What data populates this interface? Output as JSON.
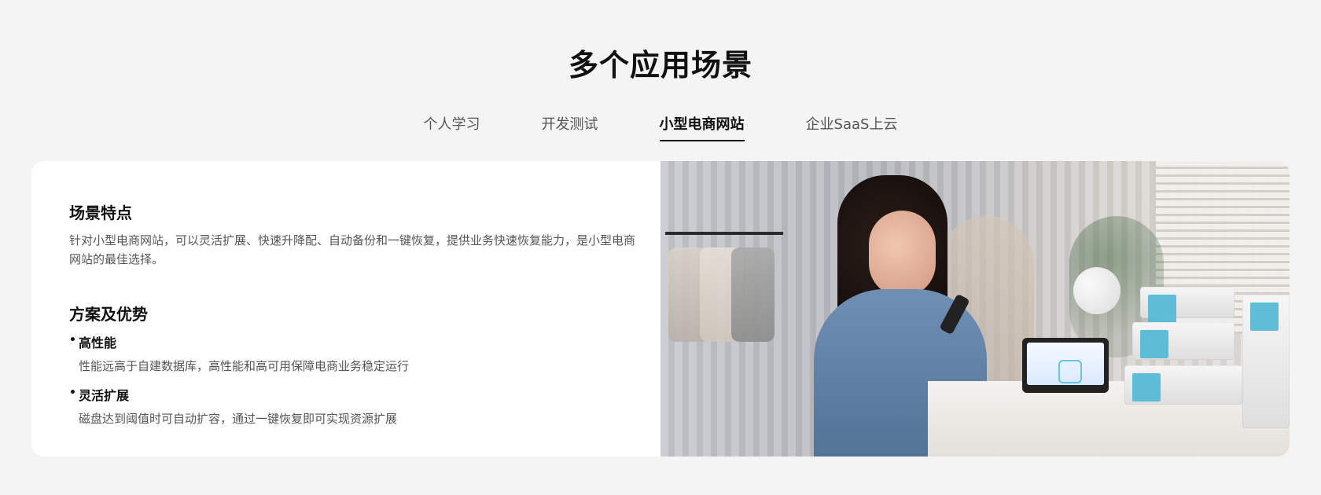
{
  "title": "多个应用场景",
  "tabs": [
    {
      "label": "个人学习",
      "active": false
    },
    {
      "label": "开发测试",
      "active": false
    },
    {
      "label": "小型电商网站",
      "active": true
    },
    {
      "label": "企业SaaS上云",
      "active": false
    }
  ],
  "card": {
    "scene": {
      "heading": "场景特点",
      "description": "针对小型电商网站，可以灵活扩展、快速升降配、自动备份和一键恢复，提供业务快速恢复能力，是小型电商网站的最佳选择。"
    },
    "advantages": {
      "heading": "方案及优势",
      "items": [
        {
          "title": "高性能",
          "text": "性能远高于自建数据库，高性能和高可用保障电商业务稳定运行"
        },
        {
          "title": "灵活扩展",
          "text": "磁盘达到阈值时可自动扩容，通过一键恢复即可实现资源扩展"
        }
      ]
    }
  },
  "colors": {
    "background": "#f4f4f4",
    "card": "#ffffff",
    "activeTab": "#111111",
    "inactiveTab": "#555555"
  }
}
